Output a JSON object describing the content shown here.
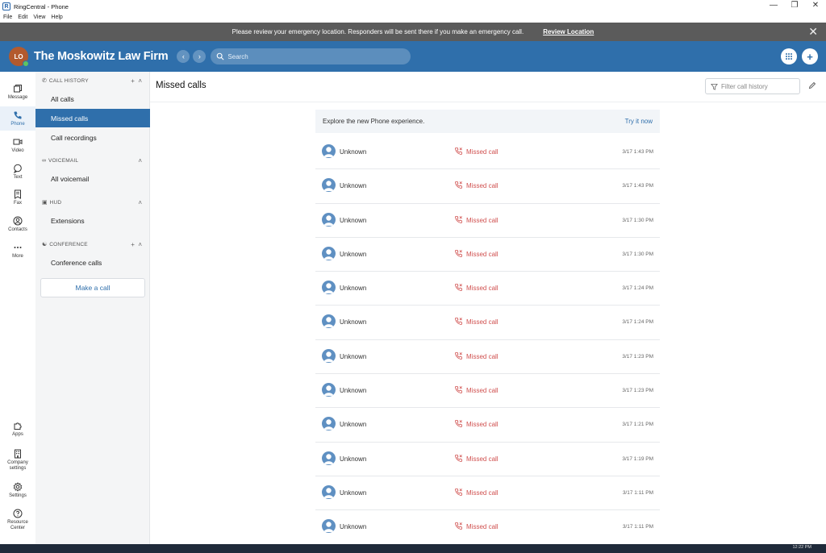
{
  "window": {
    "title": "RingCentral - Phone",
    "menu": [
      "File",
      "Edit",
      "View",
      "Help"
    ]
  },
  "banner": {
    "message": "Please review your emergency location. Responders will be sent there if you make an emergency call.",
    "link": "Review Location"
  },
  "header": {
    "avatar_initials": "LO",
    "company": "The Moskowitz Law Firm",
    "search_placeholder": "Search"
  },
  "rail": {
    "items": [
      "Message",
      "Phone",
      "Video",
      "Text",
      "Fax",
      "Contacts",
      "More"
    ],
    "bottom_items": [
      "Apps",
      "Company settings",
      "Settings",
      "Resource Center"
    ],
    "active": "Phone"
  },
  "nav": {
    "call_history_header": "CALL HISTORY",
    "call_history_items": [
      "All calls",
      "Missed calls",
      "Call recordings"
    ],
    "voicemail_header": "VOICEMAIL",
    "voicemail_items": [
      "All voicemail"
    ],
    "hud_header": "HUD",
    "hud_items": [
      "Extensions"
    ],
    "conference_header": "CONFERENCE",
    "conference_items": [
      "Conference calls"
    ],
    "make_call": "Make a call",
    "active": "Missed calls"
  },
  "main": {
    "title": "Missed calls",
    "filter_placeholder": "Filter call history",
    "promo_text": "Explore the new Phone experience.",
    "promo_link": "Try it now",
    "calls": [
      {
        "name": "Unknown",
        "status": "Missed call",
        "time": "3/17 1:43 PM"
      },
      {
        "name": "Unknown",
        "status": "Missed call",
        "time": "3/17 1:43 PM"
      },
      {
        "name": "Unknown",
        "status": "Missed call",
        "time": "3/17 1:30 PM"
      },
      {
        "name": "Unknown",
        "status": "Missed call",
        "time": "3/17 1:30 PM"
      },
      {
        "name": "Unknown",
        "status": "Missed call",
        "time": "3/17 1:24 PM"
      },
      {
        "name": "Unknown",
        "status": "Missed call",
        "time": "3/17 1:24 PM"
      },
      {
        "name": "Unknown",
        "status": "Missed call",
        "time": "3/17 1:23 PM"
      },
      {
        "name": "Unknown",
        "status": "Missed call",
        "time": "3/17 1:23 PM"
      },
      {
        "name": "Unknown",
        "status": "Missed call",
        "time": "3/17 1:21 PM"
      },
      {
        "name": "Unknown",
        "status": "Missed call",
        "time": "3/17 1:19 PM"
      },
      {
        "name": "Unknown",
        "status": "Missed call",
        "time": "3/17 1:11 PM"
      },
      {
        "name": "Unknown",
        "status": "Missed call",
        "time": "3/17 1:11 PM"
      }
    ]
  },
  "taskbar": {
    "clock": "12:22 PM"
  },
  "colors": {
    "header": "#2f6fab",
    "banner": "#5b5b5b",
    "missed": "#d0504f",
    "active_nav": "#2f6fab"
  }
}
